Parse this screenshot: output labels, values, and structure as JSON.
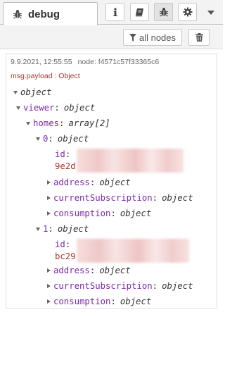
{
  "tab": {
    "label": "debug",
    "icon": "bug-icon"
  },
  "tab_buttons": [
    {
      "name": "info-icon",
      "active": false
    },
    {
      "name": "book-icon",
      "active": false
    },
    {
      "name": "bug-icon",
      "active": true
    },
    {
      "name": "gear-icon",
      "active": false
    }
  ],
  "toolbar": {
    "filter_label": "all nodes",
    "filter_icon": "filter-icon",
    "clear_icon": "trash-icon"
  },
  "message": {
    "timestamp": "9.9.2021, 12:55:55",
    "node": "node: f4571c57f33365c6",
    "topic": "msg.payload : Object"
  },
  "tree": {
    "root_type": "object",
    "viewer_key": "viewer",
    "viewer_type": "object",
    "homes_key": "homes",
    "homes_type": "array[2]",
    "item0_key": "0",
    "item0_type": "object",
    "item0_id_key": "id",
    "item0_id_prefix": "9e2d",
    "item1_key": "1",
    "item1_type": "object",
    "item1_id_key": "id",
    "item1_id_prefix": "bc29",
    "address_key": "address",
    "address_type": "object",
    "subscription_key": "currentSubscription",
    "subscription_type": "object",
    "consumption_key": "consumption",
    "consumption_type": "object"
  }
}
